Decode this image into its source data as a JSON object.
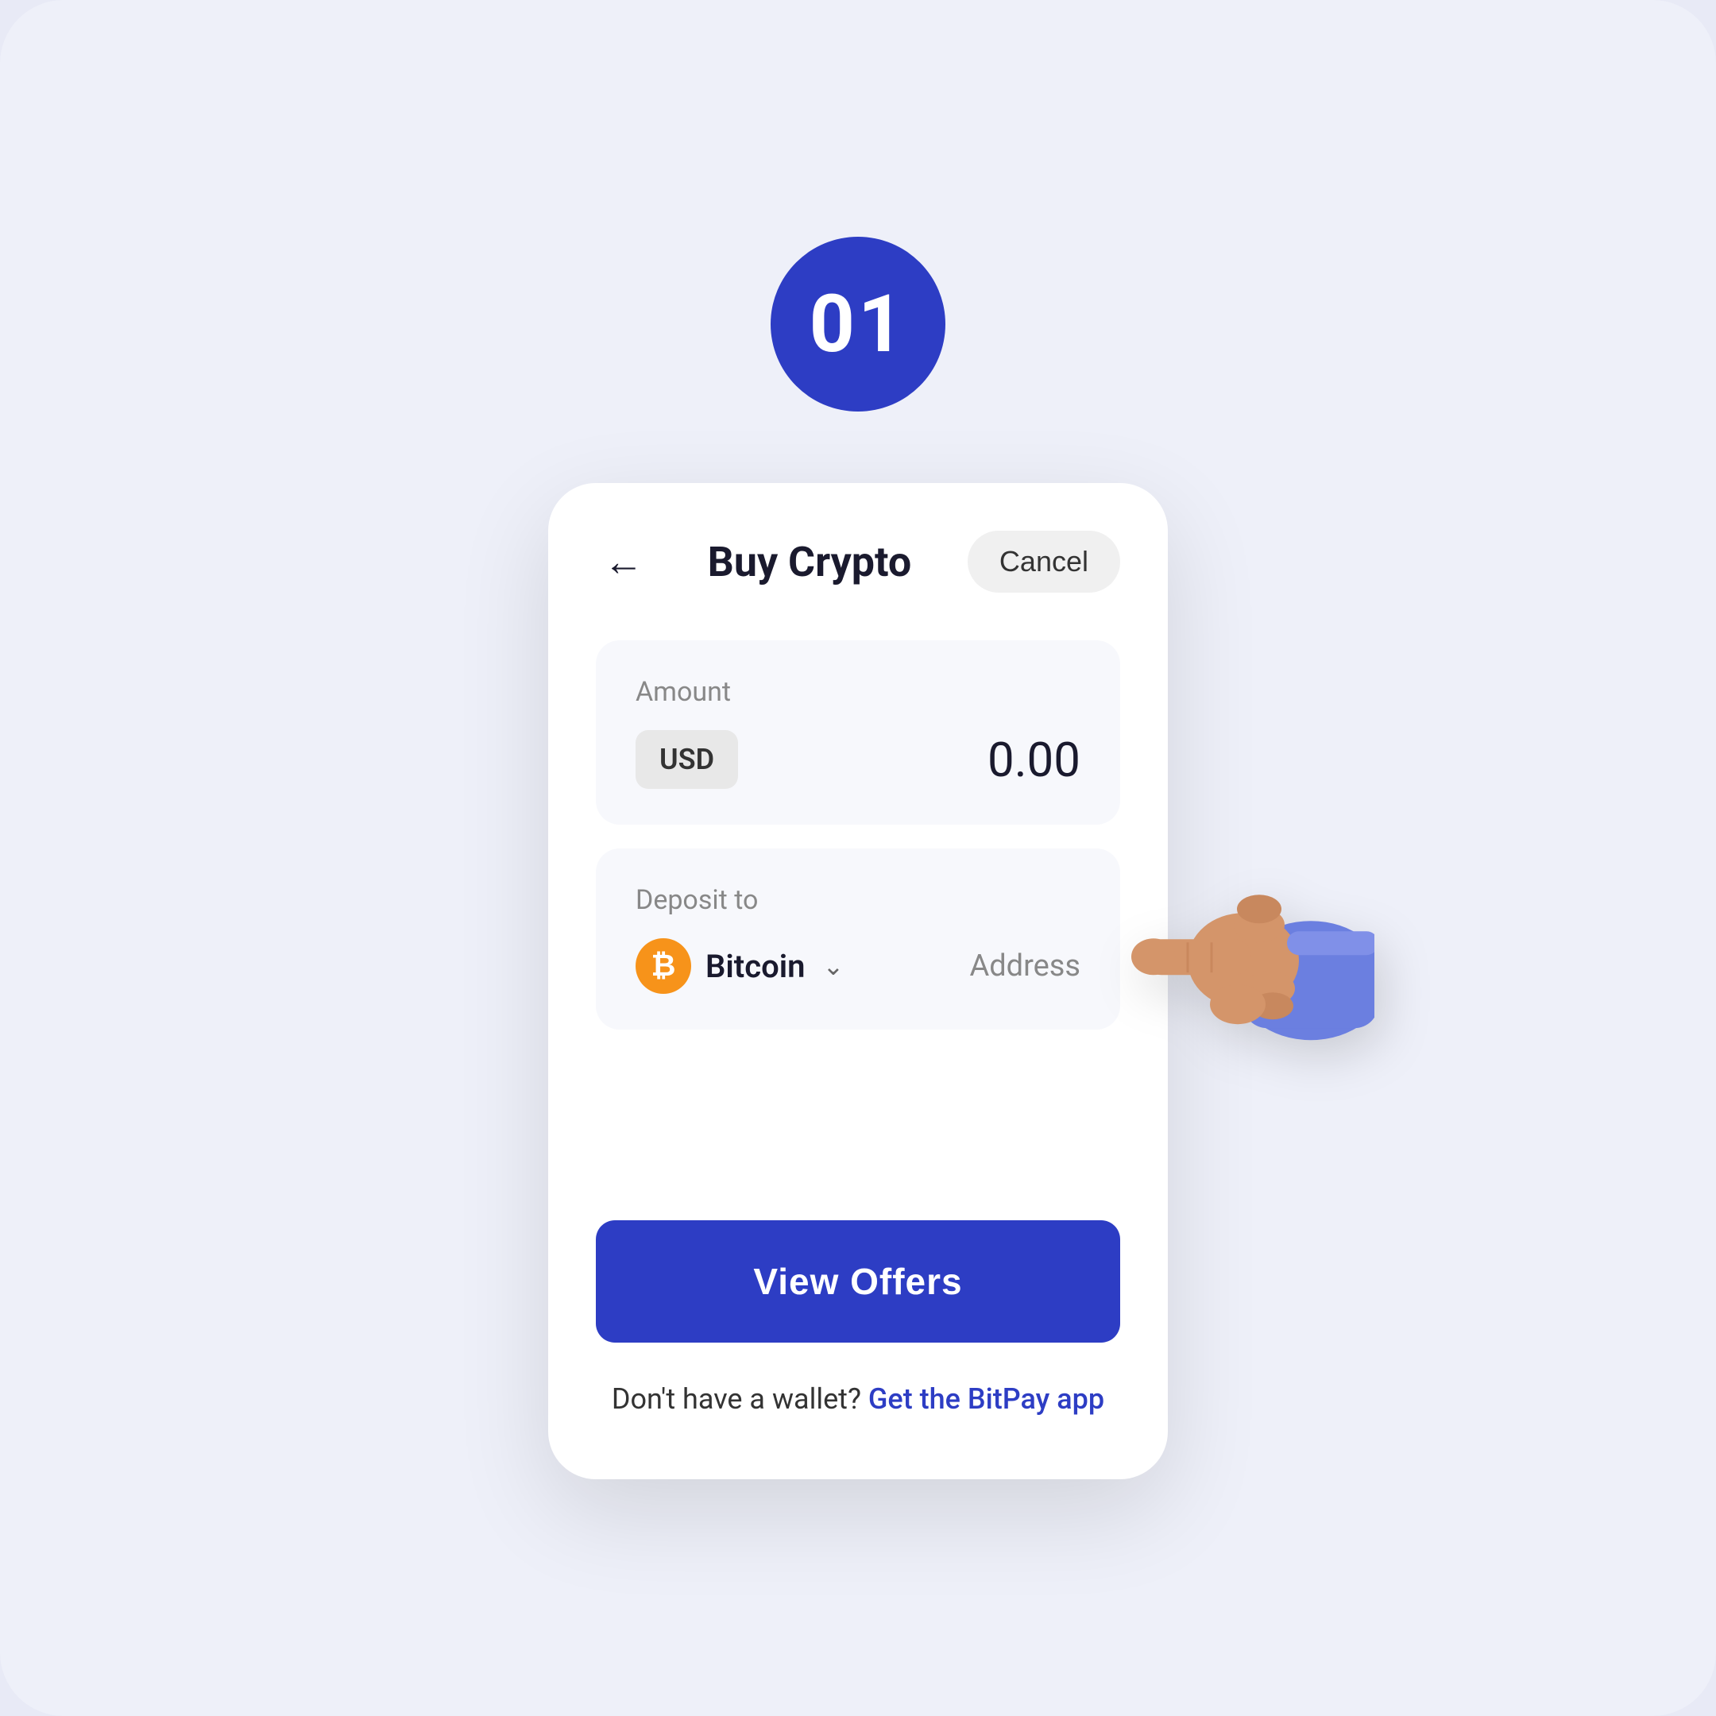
{
  "step": {
    "number": "01"
  },
  "header": {
    "title": "Buy Crypto",
    "cancel_label": "Cancel",
    "back_label": "←"
  },
  "amount_section": {
    "label": "Amount",
    "currency": "USD",
    "value": "0.00"
  },
  "deposit_section": {
    "label": "Deposit to",
    "crypto_name": "Bitcoin",
    "address_label": "Address"
  },
  "cta": {
    "view_offers_label": "View Offers"
  },
  "footer": {
    "text": "Don't have a wallet?",
    "link_text": "Get the BitPay app"
  },
  "colors": {
    "accent": "#2d3dc4",
    "bitcoin_orange": "#f7931a",
    "background": "#eef0f9",
    "card_bg": "#f7f8fc",
    "text_primary": "#1a1a2e",
    "text_muted": "#888888"
  }
}
